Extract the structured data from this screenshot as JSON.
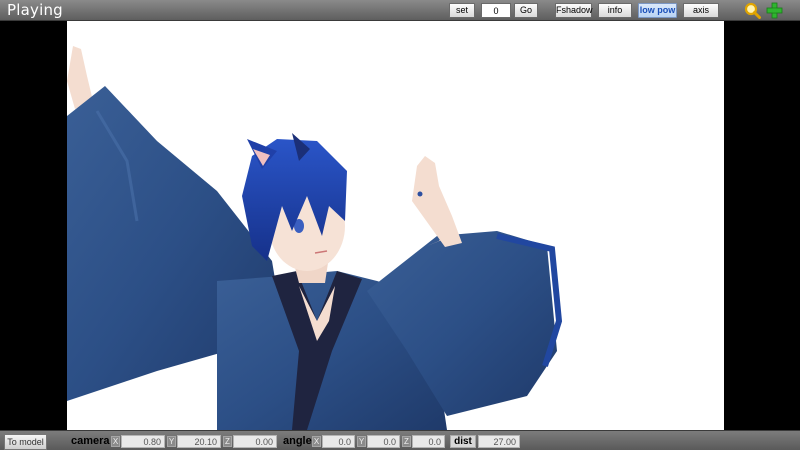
{
  "window": {
    "title": "Playing"
  },
  "toolbar": {
    "set_label": "set",
    "frame_value": "0",
    "go_label": "Go",
    "fshadow_label": "Fshadow",
    "info_label": "info",
    "low_pow_label": "low pow",
    "axis_label": "axis",
    "zoom_icon": "magnifier-icon",
    "add_icon": "plus-icon"
  },
  "bottom": {
    "to_model_label": "To model",
    "camera_label": "camera",
    "camera": {
      "x_label": "X",
      "x": "0.80",
      "y_label": "Y",
      "y": "20.10",
      "z_label": "Z",
      "z": "0.00"
    },
    "angle_label": "angle",
    "angle": {
      "x_label": "X",
      "x": "0.0",
      "y_label": "Y",
      "y": "0.0",
      "z_label": "Z",
      "z": "0.0"
    },
    "dist_label": "dist",
    "dist": "27.00"
  },
  "colors": {
    "toolbar": "#6e6e6e",
    "viewport_bg": "#ffffff",
    "robe": "#2c4f86",
    "hair": "#1d3fa8",
    "active_button": "#1a4fb8",
    "add_icon": "#2fb52f",
    "zoom_icon": "#e0a400"
  }
}
